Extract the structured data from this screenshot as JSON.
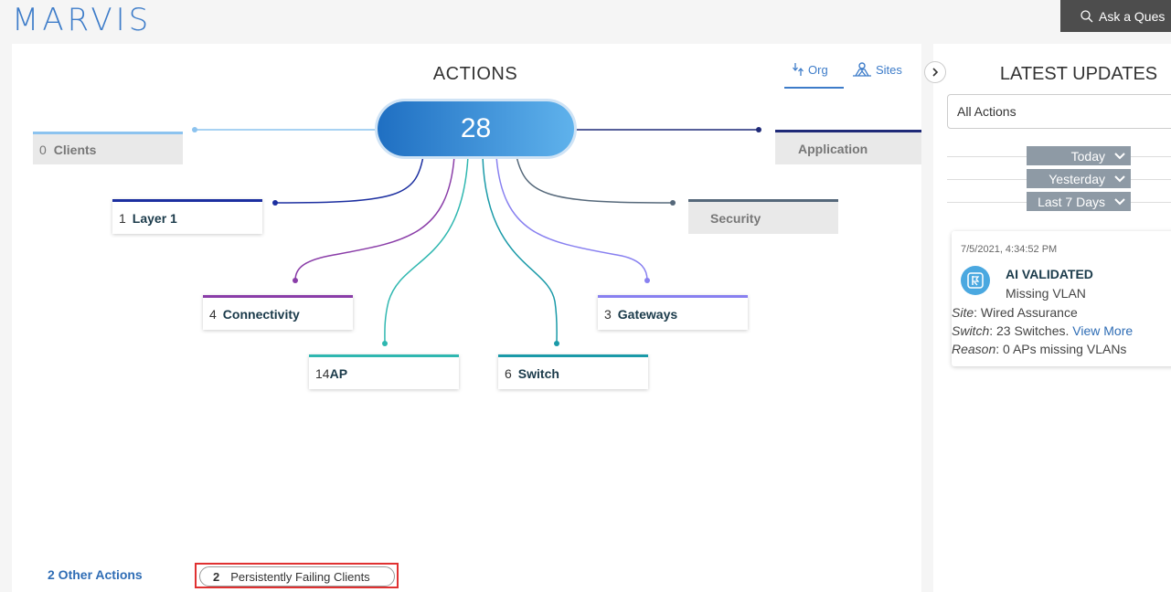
{
  "app": {
    "logo": "MARVIS",
    "ask_label": "Ask a Ques"
  },
  "actions": {
    "title": "ACTIONS",
    "total": "28",
    "toggle": {
      "org": "Org",
      "sites": "Sites"
    },
    "categories": {
      "clients": {
        "count": "0",
        "label": "Clients"
      },
      "application": {
        "label": "Application"
      },
      "layer1": {
        "count": "1",
        "label": "Layer 1"
      },
      "security": {
        "label": "Security"
      },
      "connectivity": {
        "count": "4",
        "label": "Connectivity"
      },
      "gateways": {
        "count": "3",
        "label": "Gateways"
      },
      "ap": {
        "count": "14",
        "label": "AP"
      },
      "switch": {
        "count": "6",
        "label": "Switch"
      }
    },
    "other_actions": "2 Other Actions",
    "persistently_failing": {
      "count": "2",
      "label": "Persistently Failing Clients"
    }
  },
  "latest": {
    "title": "LATEST UPDATES",
    "filter": "All Actions",
    "time_groups": [
      "Today",
      "Yesterday",
      "Last 7 Days"
    ],
    "card": {
      "timestamp": "7/5/2021, 4:34:52 PM",
      "status": "AI VALIDATED",
      "subtitle": "Missing VLAN",
      "site_label": "Site",
      "site_value": ": Wired Assurance",
      "switch_label": "Switch",
      "switch_value": ": 23 Switches.",
      "view_more": "View More",
      "reason_label": "Reason",
      "reason_value": ": 0 APs missing VLANs"
    }
  },
  "colors": {
    "brand": "#3d7cc9",
    "clients": "#8cc3ef",
    "application": "#1f2a78",
    "layer1": "#1c2fa0",
    "security": "#55687a",
    "connectivity": "#8a3da8",
    "gateways": "#8880f0",
    "ap": "#2fb7b0",
    "switch": "#1a9aa8",
    "highlight": "#e03131"
  }
}
